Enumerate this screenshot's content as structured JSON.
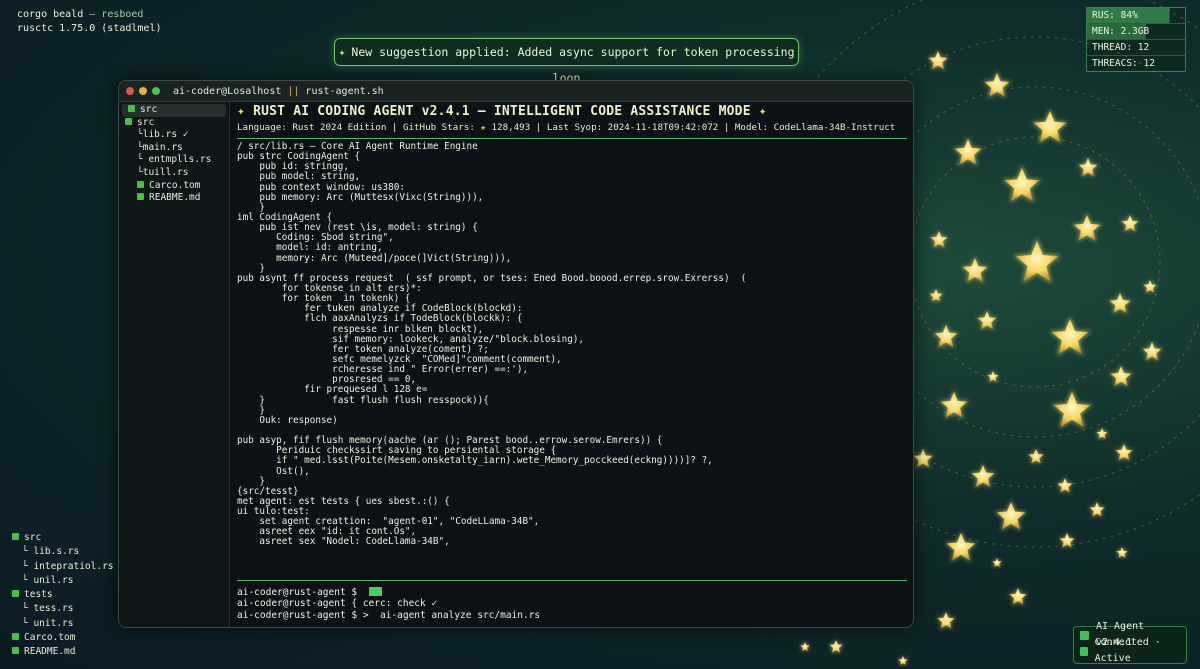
{
  "top_left": {
    "line1": "corgo beald",
    "line1_dim": "— resboed",
    "line2": "rusctc 1.75.0 (stadlmel)"
  },
  "stats": [
    {
      "label": "RUS: 84%"
    },
    {
      "label": "MEN: 2.3GB"
    },
    {
      "label": "THREAD: 12"
    },
    {
      "label": "THREACS: 12"
    }
  ],
  "suggestion": {
    "icon": "sparkle-icon",
    "text": "New suggestion applied: Added async support for token processing loop"
  },
  "window": {
    "title": "ai-coder@Losalhost",
    "separator": "||",
    "file": "rust-agent.sh"
  },
  "sidebar": [
    {
      "label": "src",
      "indent": 0,
      "folder": true,
      "selected": true
    },
    {
      "label": "src",
      "indent": 0,
      "folder": true
    },
    {
      "label": "└lib.rs ✓",
      "indent": 1
    },
    {
      "label": "└main.rs",
      "indent": 1
    },
    {
      "label": "└ entmplls.rs",
      "indent": 1
    },
    {
      "label": "└tuill.rs",
      "indent": 1
    },
    {
      "label": "Carco.tom",
      "indent": 1,
      "folder": true
    },
    {
      "label": "REABME.md",
      "indent": 1,
      "folder": true
    }
  ],
  "header": {
    "title": "RUST AI CODING AGENT v2.4.1 — INTELLIGENT CODE ASSISTANCE MODE",
    "meta_pre": "Language: Rust 2024 Edition | GitHub Stars:",
    "meta_post": "128,493 | Last Syop: 2024-11-18T09:42:072 | Model: CodeLlama-34B-Instruct"
  },
  "code_lines": [
    "/ src/lib.rs — Core AI Agent Runtime Engine",
    "pub strc CodingAgent {",
    "    pub id: stringg,",
    "    pub model: string,",
    "    pub context window: us380:",
    "    pub memory: Arc (Muttesx(Vixc(String))),",
    "    }",
    "iml CodingAgent {",
    "    pub ist nev (rest \\is, model: string) {",
    "       Coding: Sbod string\",",
    "       model: id: antring,",
    "       memory: Arc (Muteed]/poce(]Vict(String))),",
    "    }",
    "pub asynt ff process request  ( ssf prompt, or tses: Ened Bood.boood.errep.srow.Exrerss)  (",
    "        for tokense in alt ers)*:",
    "        for token  in tokenk) {",
    "            fer tuken analyze if CodeBlock(blockd):",
    "            flch aaxAnalyzs if TodeBlock(blockk): {",
    "                 respesse inr blken blockt),",
    "                 sif memory: lookeck, analyze/\"block.blosing),",
    "                 fer token analyze(coment) ?;",
    "                 sefc memelyzck  \"COMed]\"comment(comment),",
    "                 rcheresse ind \" Error(errer) ==:'),",
    "                 prosresed == 0,",
    "            fir prequesed l 128 e=",
    "    }            fast flush flush resspock)){",
    "    }",
    "    Ouk: response)",
    "",
    "pub asyp, fif flush memory(aache (ar (); Parest bood..errow.serow.Emrers)) {",
    "       Periduic checkssirt saving to persiental storage {",
    "       if \" med.lsst(Poite(Mesem.onsketalty_iarn).wete_Memory_pocckeed(eckng))))]? ?,",
    "       Ost(),",
    "    }",
    "{src/tesst}",
    "met agent: est tests { ues sbest.:() {",
    "ui tulo:test:",
    "    set agent creattion:  \"agent-01\", \"CodeLLama-34B\",",
    "    asreet eex \"id: it cont.Os\",",
    "    asreet sex \"Nodel: CodeLlama-34B\","
  ],
  "prompt_lines": [
    {
      "text": "ai-coder@rust-agent $  ",
      "cursor": true
    },
    {
      "text": "ai-coder@rust-agent { cerc: check ✓",
      "cursor": false
    },
    {
      "text": "ai-coder@rust-agent $ >  ai-agent analyze src/main.rs",
      "cursor": false
    }
  ],
  "bottom_tree": [
    {
      "label": "src",
      "folder": true,
      "indent": 0
    },
    {
      "label": "└ lib.s.rs",
      "indent": 1
    },
    {
      "label": "└ intepratiol.rs",
      "indent": 1
    },
    {
      "label": "└ unil.rs",
      "indent": 1
    },
    {
      "label": "tests",
      "folder": true,
      "indent": 0
    },
    {
      "label": "└ tess.rs",
      "indent": 1
    },
    {
      "label": "└ unit.rs",
      "indent": 1
    },
    {
      "label": "Carco.tom",
      "folder": true,
      "indent": 0
    },
    {
      "label": "README.md",
      "folder": true,
      "indent": 0
    }
  ],
  "status": {
    "line1": "AI Agent v2.4.1",
    "line2": "Connected · Active"
  },
  "colors": {
    "accent_green": "#3ed35b",
    "star_gold": "#f2d46a",
    "rule_green": "#56b86a"
  }
}
